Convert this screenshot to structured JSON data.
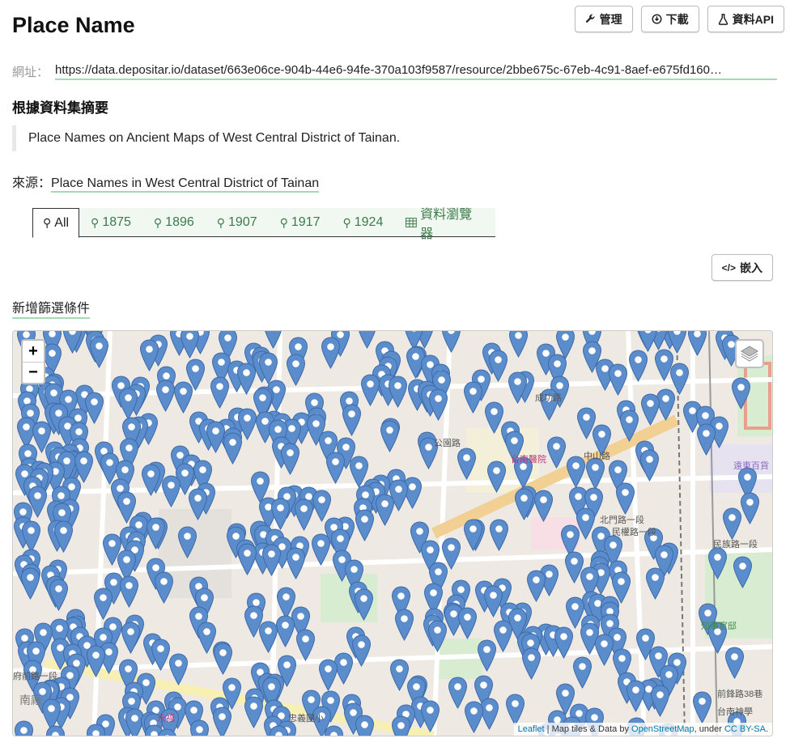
{
  "page": {
    "title": "Place Name",
    "actions": {
      "manage": "管理",
      "download": "下載",
      "api": "資料API"
    },
    "url_label": "網址：",
    "url": "https://data.depositar.io/dataset/663e06ce-904b-44e6-94fe-370a103f9587/resource/2bbe675c-67eb-4c91-8aef-e675fd160…",
    "summary_heading": "根據資料集摘要",
    "summary_text": "Place Names on Ancient Maps of West Central District of Tainan.",
    "source_label": "來源：",
    "source_link": "Place Names in West Central District of Tainan",
    "tabs": [
      {
        "label": "All",
        "icon": "map-marker-icon",
        "active": true
      },
      {
        "label": "1875",
        "icon": "map-marker-icon"
      },
      {
        "label": "1896",
        "icon": "map-marker-icon"
      },
      {
        "label": "1907",
        "icon": "map-marker-icon"
      },
      {
        "label": "1917",
        "icon": "map-marker-icon"
      },
      {
        "label": "1924",
        "icon": "map-marker-icon"
      },
      {
        "label": "資料瀏覽器",
        "icon": "table-icon"
      }
    ],
    "embed": "嵌入",
    "add_filter": "新增篩選條件"
  },
  "map": {
    "zoom_in": "+",
    "zoom_out": "−",
    "attribution": {
      "leaflet": "Leaflet",
      "sep": " | Map tiles & Data by ",
      "osm": "OpenStreetMap",
      "under": ", under ",
      "license": "CC BY-SA",
      "end": "."
    },
    "labels": [
      {
        "text": "民族路一段"
      },
      {
        "text": "中山路"
      },
      {
        "text": "北門路一段"
      },
      {
        "text": "民權路一段"
      },
      {
        "text": "府前路一段"
      },
      {
        "text": "南廠"
      },
      {
        "text": "台南醫院"
      },
      {
        "text": "遠東百貨"
      },
      {
        "text": "知事官邸"
      },
      {
        "text": "成功路"
      },
      {
        "text": "公園路"
      },
      {
        "text": "前鋒路38巷"
      },
      {
        "text": "台南神學"
      },
      {
        "text": "忠義國小"
      },
      {
        "text": "永福"
      }
    ],
    "marker_color": "#5b8ccc",
    "marker_count_note": "dense cluster of blue place-name markers"
  }
}
